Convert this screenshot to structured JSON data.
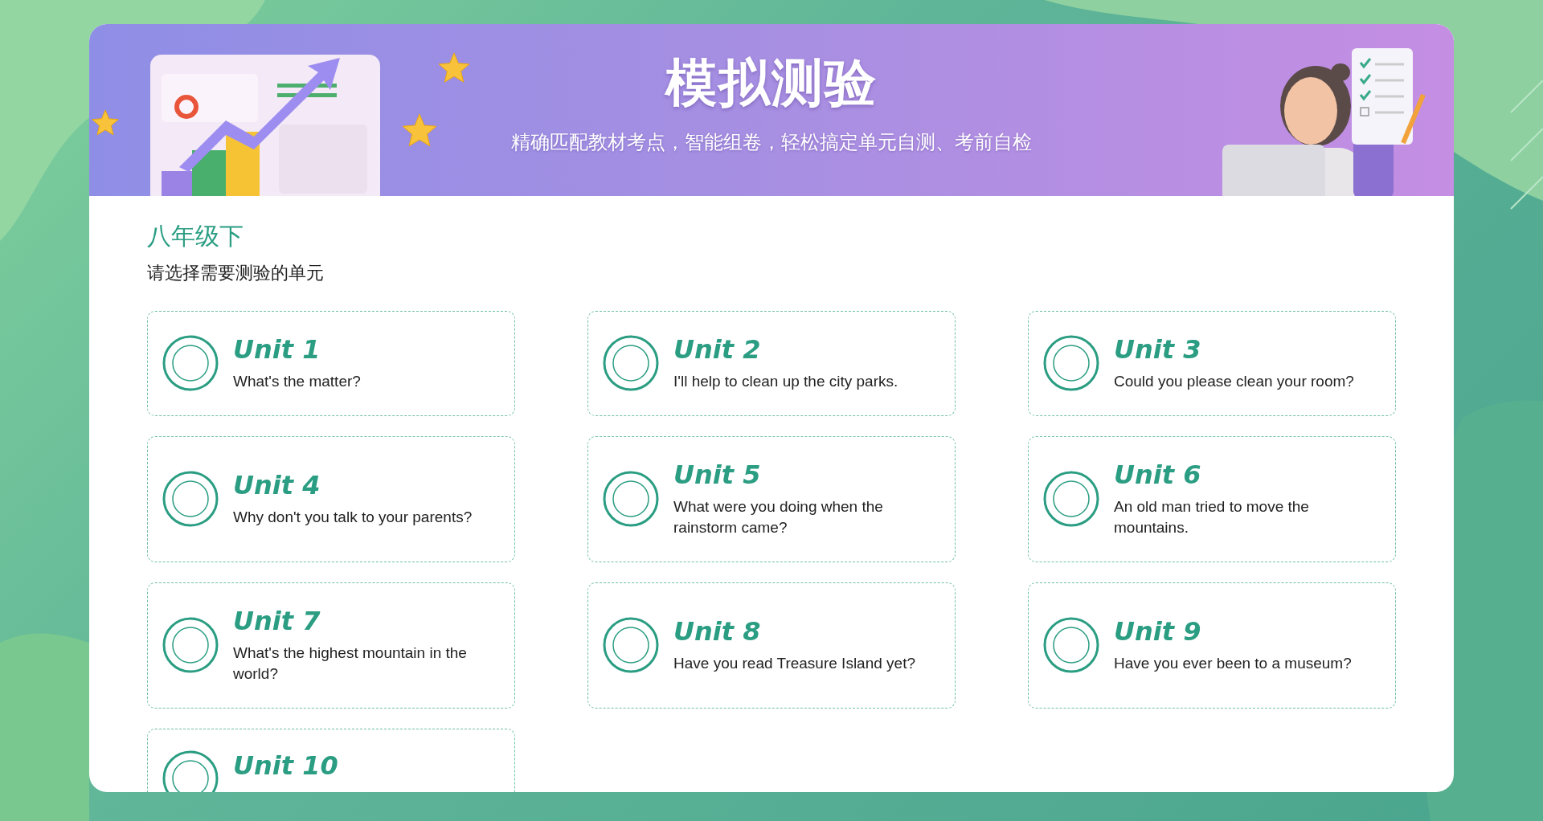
{
  "header": {
    "title": "模拟测验",
    "subtitle": "精确匹配教材考点，智能组卷，轻松搞定单元自测、考前自检"
  },
  "section": {
    "grade": "八年级下",
    "prompt": "请选择需要测验的单元"
  },
  "units": [
    {
      "title": "Unit 1",
      "description": "What's the matter?",
      "selected": false
    },
    {
      "title": "Unit 2",
      "description": "I'll help to clean up the city parks.",
      "selected": false
    },
    {
      "title": "Unit 3",
      "description": "Could you please clean your room?",
      "selected": false
    },
    {
      "title": "Unit 4",
      "description": "Why don't you talk to your parents?",
      "selected": false
    },
    {
      "title": "Unit 5",
      "description": "What were you doing when the rainstorm came?",
      "selected": false
    },
    {
      "title": "Unit 6",
      "description": "An old man tried to move the mountains.",
      "selected": false
    },
    {
      "title": "Unit 7",
      "description": "What's the highest mountain in the world?",
      "selected": false
    },
    {
      "title": "Unit 8",
      "description": "Have you read Treasure Island yet?",
      "selected": false
    },
    {
      "title": "Unit 9",
      "description": "Have you ever been to a museum?",
      "selected": false
    },
    {
      "title": "Unit 10",
      "selected": false
    }
  ]
}
